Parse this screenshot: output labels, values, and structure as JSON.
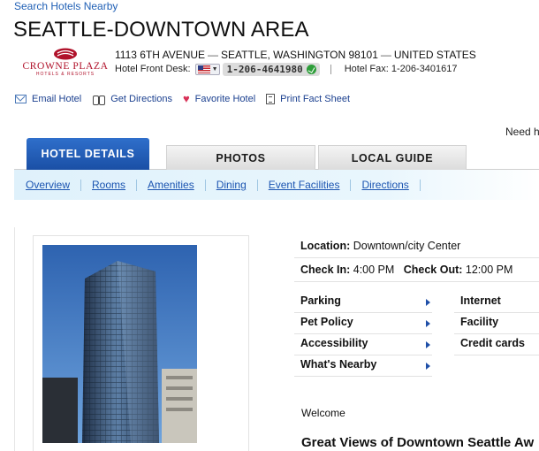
{
  "top_link": "Search Hotels Nearby",
  "hotel_name": "SEATTLE-DOWNTOWN AREA",
  "brand": {
    "name": "CROWNE PLAZA",
    "sub": "HOTELS & RESORTS",
    "color": "#b0112a"
  },
  "address": {
    "street": "1113 6TH AVENUE",
    "city": "SEATTLE, WASHINGTON 98101",
    "country": "UNITED STATES",
    "separator": "—"
  },
  "contact": {
    "front_desk_label": "Hotel Front Desk:",
    "phone": "1-206-4641980",
    "fax_label": "Hotel Fax:",
    "fax": "1-206-3401617"
  },
  "actions": [
    {
      "label": "Email Hotel",
      "icon": "envelope-icon"
    },
    {
      "label": "Get Directions",
      "icon": "binoculars-icon"
    },
    {
      "label": "Favorite Hotel",
      "icon": "heart-icon"
    },
    {
      "label": "Print Fact Sheet",
      "icon": "document-icon"
    }
  ],
  "need_help": "Need h",
  "tabs": [
    {
      "label": "HOTEL DETAILS",
      "active": true
    },
    {
      "label": "PHOTOS",
      "active": false
    },
    {
      "label": "LOCAL GUIDE",
      "active": false
    }
  ],
  "subnav": [
    "Overview",
    "Rooms",
    "Amenities",
    "Dining",
    "Event Facilities",
    "Directions"
  ],
  "details": {
    "location_label": "Location:",
    "location_value": "Downtown/city Center",
    "checkin_label": "Check In:",
    "checkin_value": "4:00 PM",
    "checkout_label": "Check Out:",
    "checkout_value": "12:00 PM"
  },
  "amenities_left": [
    "Parking",
    "Pet Policy",
    "Accessibility",
    "What's Nearby"
  ],
  "amenities_right": [
    "Internet",
    "Facility",
    "Credit cards"
  ],
  "welcome": "Welcome",
  "headline": "Great Views of Downtown Seattle Aw",
  "colors": {
    "link": "#1f5fb5",
    "tab_active": "#1f5ab8",
    "subnav_bg": "#e3f3fb"
  }
}
